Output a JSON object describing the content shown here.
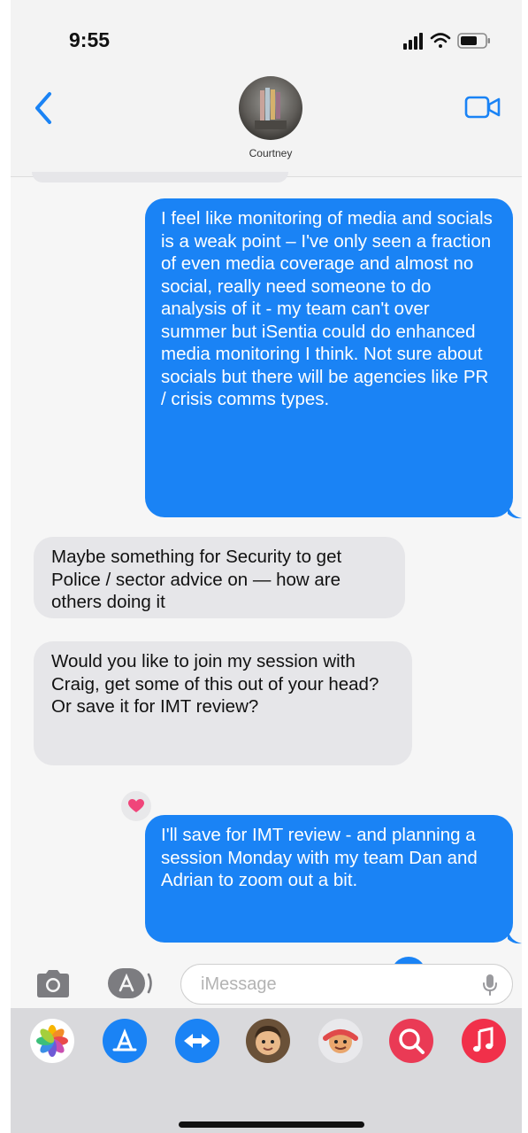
{
  "status_bar": {
    "time": "9:55"
  },
  "header": {
    "contact_name": "Courtney"
  },
  "messages": [
    {
      "direction": "outgoing",
      "text": "I feel like monitoring of media and socials is a weak point – I've only seen a fraction of even media coverage and almost no social, really need someone to do analysis of it - my team can't over summer but iSentia could do enhanced media monitoring I think. Not sure about socials but there will be agencies like PR / crisis comms types."
    },
    {
      "direction": "incoming",
      "text": "Maybe something for Security to get Police / sector advice on — how are others doing it"
    },
    {
      "direction": "incoming",
      "text": "Would you like to join my session with Craig, get some of this out of your head? Or save it for IMT review?"
    },
    {
      "direction": "outgoing",
      "text": "I'll save for IMT review - and planning a session Monday with my team Dan and Adrian to zoom out a bit."
    }
  ],
  "input": {
    "placeholder": "iMessage"
  },
  "app_drawer": [
    {
      "icon": "photos-icon"
    },
    {
      "icon": "app-store-icon"
    },
    {
      "icon": "audio-message-icon"
    },
    {
      "icon": "memoji-icon"
    },
    {
      "icon": "memoji-stickers-icon"
    },
    {
      "icon": "images-search-icon"
    },
    {
      "icon": "music-icon"
    }
  ],
  "colors": {
    "accent": "#1a83f5",
    "outgoing_bubble": "#1a83f5",
    "incoming_bubble": "#e6e6e9",
    "heart": "#f0457a"
  }
}
